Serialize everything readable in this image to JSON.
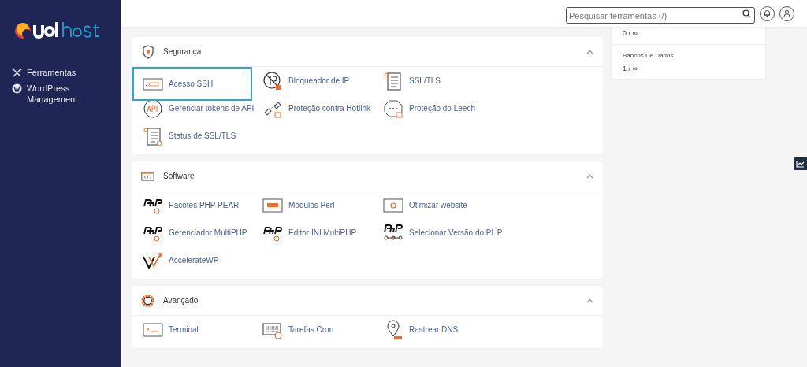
{
  "sidebar": {
    "items": [
      {
        "label": "Ferramentas"
      },
      {
        "label": "WordPress Management"
      }
    ]
  },
  "search": {
    "placeholder": "Pesquisar ferramentas (/)"
  },
  "sections": [
    {
      "title": "Segurança",
      "expanded": true,
      "items": [
        {
          "label": "Acesso SSH",
          "selected": true
        },
        {
          "label": "Bloqueador de IP",
          "selected": false
        },
        {
          "label": "SSL/TLS",
          "selected": false
        },
        {
          "label": "Gerenciar tokens de API",
          "selected": false
        },
        {
          "label": "Proteção contra Hotlink",
          "selected": false
        },
        {
          "label": "Proteção do Leech",
          "selected": false
        },
        {
          "label": "Status de SSL/TLS",
          "selected": false
        }
      ]
    },
    {
      "title": "Software",
      "expanded": true,
      "items": [
        {
          "label": "Pacotes PHP PEAR",
          "selected": false
        },
        {
          "label": "Módulos Perl",
          "selected": false
        },
        {
          "label": "Otimizar website",
          "selected": false
        },
        {
          "label": "Gerenciador MultiPHP",
          "selected": false
        },
        {
          "label": "Editor INI MultiPHP",
          "selected": false
        },
        {
          "label": "Selecionar Versão do PHP",
          "selected": false
        },
        {
          "label": "AccelerateWP",
          "selected": false
        }
      ]
    },
    {
      "title": "Avançado",
      "expanded": true,
      "items": [
        {
          "label": "Terminal",
          "selected": false
        },
        {
          "label": "Tarefas Cron",
          "selected": false
        },
        {
          "label": "Rastrear DNS",
          "selected": false
        }
      ]
    }
  ],
  "stats": [
    {
      "value": "0 / ∞"
    },
    {
      "label": "Bancos De Dados",
      "value": "1 / ∞"
    }
  ]
}
